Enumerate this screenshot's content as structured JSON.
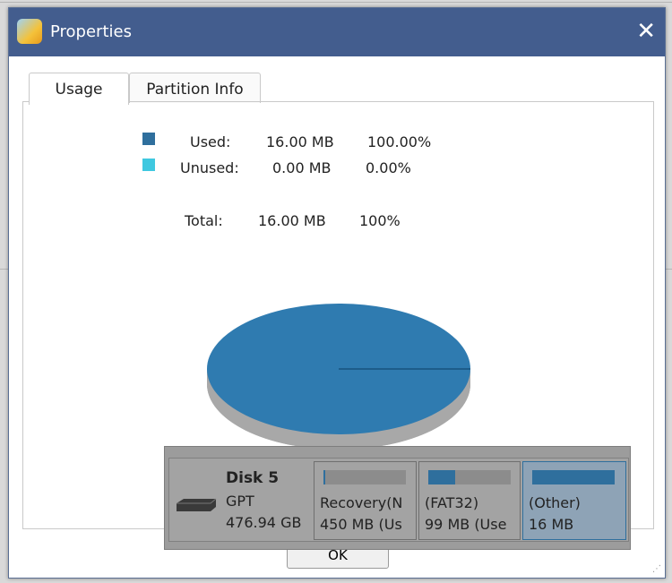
{
  "window": {
    "title": "Properties",
    "close_label": "✕"
  },
  "tabs": [
    {
      "label": "Usage",
      "active": true
    },
    {
      "label": "Partition Info",
      "active": false
    }
  ],
  "usage": {
    "used": {
      "label": "Used:",
      "size": "16.00 MB",
      "percent": "100.00%",
      "color": "#2f6f9d"
    },
    "unused": {
      "label": "Unused:",
      "size": "0.00 MB",
      "percent": "0.00%",
      "color": "#3fc8e0"
    },
    "total": {
      "label": "Total:",
      "size": "16.00 MB",
      "percent": "100%"
    }
  },
  "chart_data": {
    "type": "pie",
    "categories": [
      "Used",
      "Unused"
    ],
    "values": [
      16.0,
      0.0
    ],
    "unit": "MB"
  },
  "disk_map": {
    "disk": {
      "name": "Disk 5",
      "type": "GPT",
      "size": "476.94 GB"
    },
    "partitions": [
      {
        "name": "Recovery(N",
        "size": "450 MB (Us",
        "used_fraction": 0.02
      },
      {
        "name": "(FAT32)",
        "size": "99 MB (Use",
        "used_fraction": 0.33
      },
      {
        "name": "(Other)",
        "size": "16 MB",
        "used_fraction": 1.0,
        "selected": true
      }
    ]
  },
  "buttons": {
    "ok": "OK"
  }
}
